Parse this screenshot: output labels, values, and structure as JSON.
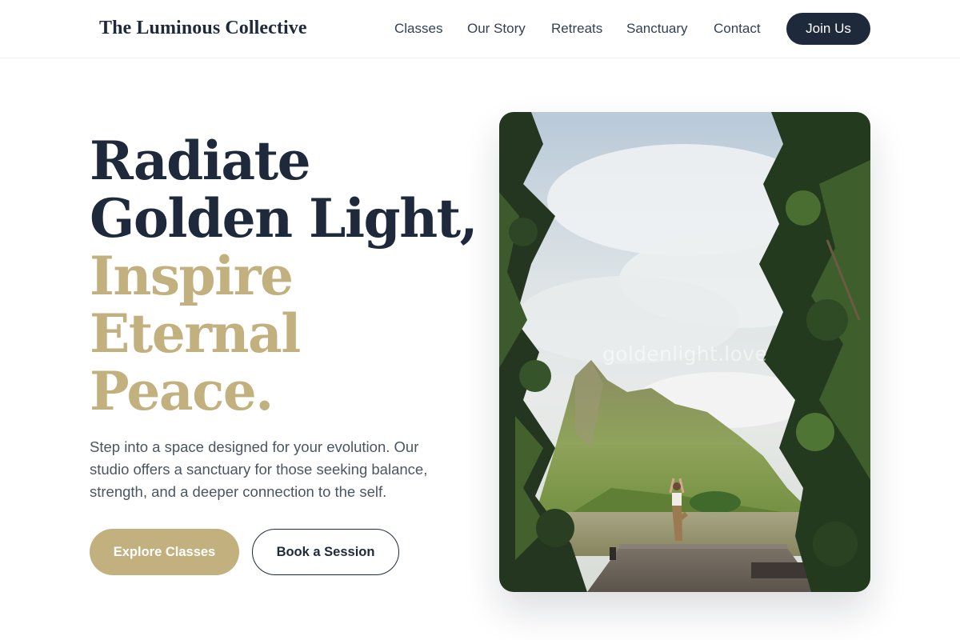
{
  "header": {
    "brand": "The Luminous Collective",
    "nav": [
      {
        "label": "Classes"
      },
      {
        "label": "Our Story"
      },
      {
        "label": "Retreats"
      },
      {
        "label": "Sanctuary"
      },
      {
        "label": "Contact"
      }
    ],
    "cta_label": "Join Us"
  },
  "hero": {
    "headline_dark": [
      "Radiate",
      "Golden Light,"
    ],
    "headline_gold": [
      "Inspire",
      "Eternal",
      "Peace."
    ],
    "description": "Step into a space designed for your evolution. Our studio offers a sanctuary for those seeking balance, strength, and a deeper connection to the self.",
    "primary_button": "Explore Classes",
    "secondary_button": "Book a Session",
    "image_watermark": "goldenlight.love"
  },
  "colors": {
    "navy": "#1e293b",
    "gold": "#c2b07e",
    "body_text": "#4b5563"
  }
}
